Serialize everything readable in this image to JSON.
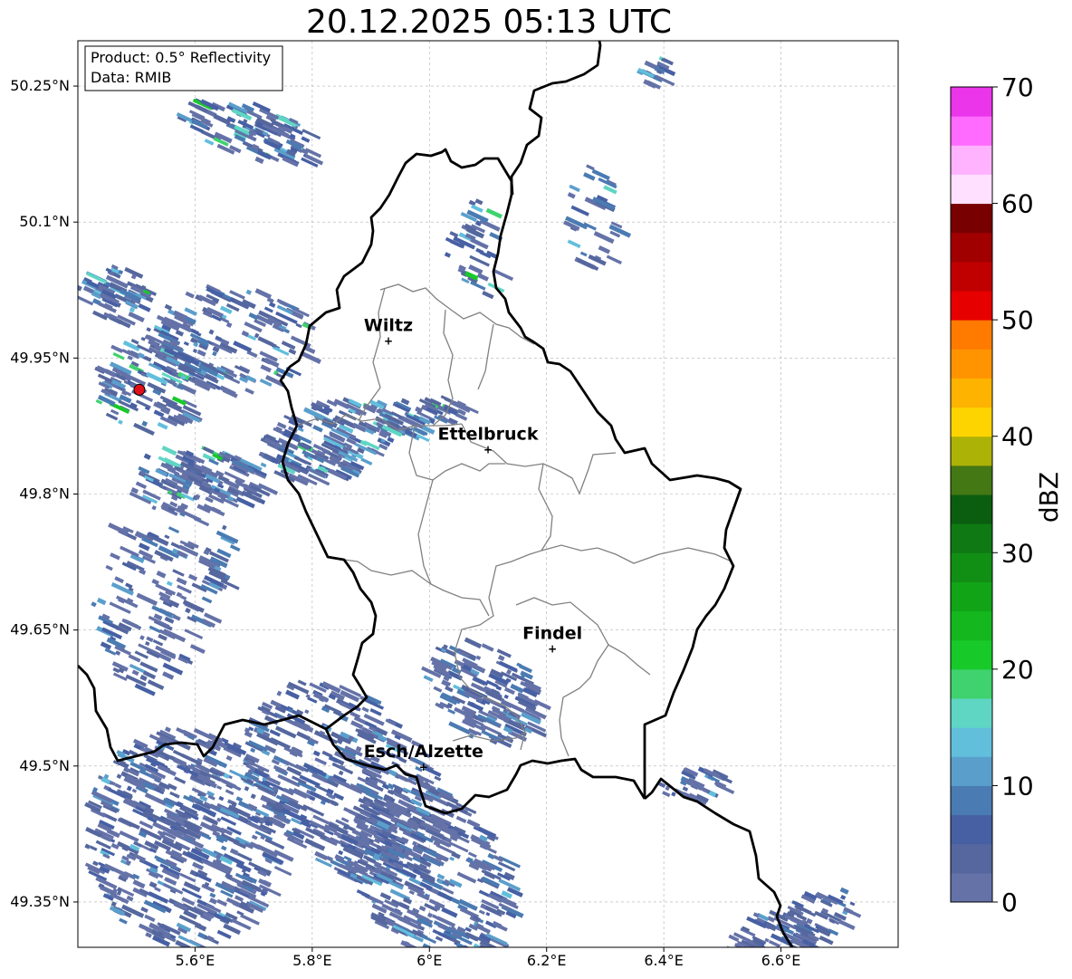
{
  "title": "20.12.2025 05:13 UTC",
  "info_box": {
    "product": "Product: 0.5° Reflectivity",
    "data": "Data: RMIB"
  },
  "map": {
    "lon_range": [
      5.4,
      6.8
    ],
    "lat_range": [
      49.3,
      50.3
    ],
    "lon_ticks": [
      "5.6°E",
      "5.8°E",
      "6°E",
      "6.2°E",
      "6.4°E",
      "6.6°E"
    ],
    "lat_ticks": [
      "49.35°N",
      "49.5°N",
      "49.65°N",
      "49.8°N",
      "49.95°N",
      "50.1°N",
      "50.25°N"
    ],
    "grid": true,
    "radar_site": {
      "lon": 5.505,
      "lat": 49.915,
      "color": "#e0101a"
    },
    "cities": [
      {
        "name": "Wiltz",
        "lon": 5.93,
        "lat": 49.97
      },
      {
        "name": "Ettelbruck",
        "lon": 6.1,
        "lat": 49.85
      },
      {
        "name": "Findel",
        "lon": 6.21,
        "lat": 49.63
      },
      {
        "name": "Esch/Alzette",
        "lon": 5.99,
        "lat": 49.5
      }
    ],
    "border_color": "#000000",
    "canton_color": "#808080"
  },
  "colorbar": {
    "label": "dBZ",
    "ticks": [
      "0",
      "10",
      "20",
      "30",
      "40",
      "50",
      "60",
      "70"
    ],
    "min": 0,
    "max": 70,
    "colors": [
      "#6472a8",
      "#55679e",
      "#4760a4",
      "#4a7bb2",
      "#5a9fcc",
      "#62bfdc",
      "#5fd6c3",
      "#3fd26e",
      "#18c92a",
      "#14b81e",
      "#12a417",
      "#118f15",
      "#0f7a13",
      "#0b5e10",
      "#447814",
      "#adb206",
      "#fdd400",
      "#fdb300",
      "#ff9400",
      "#ff7b00",
      "#e60000",
      "#c00000",
      "#a00000",
      "#780000",
      "#ffe1ff",
      "#ffb3ff",
      "#ff6bff",
      "#ea35ea"
    ]
  }
}
